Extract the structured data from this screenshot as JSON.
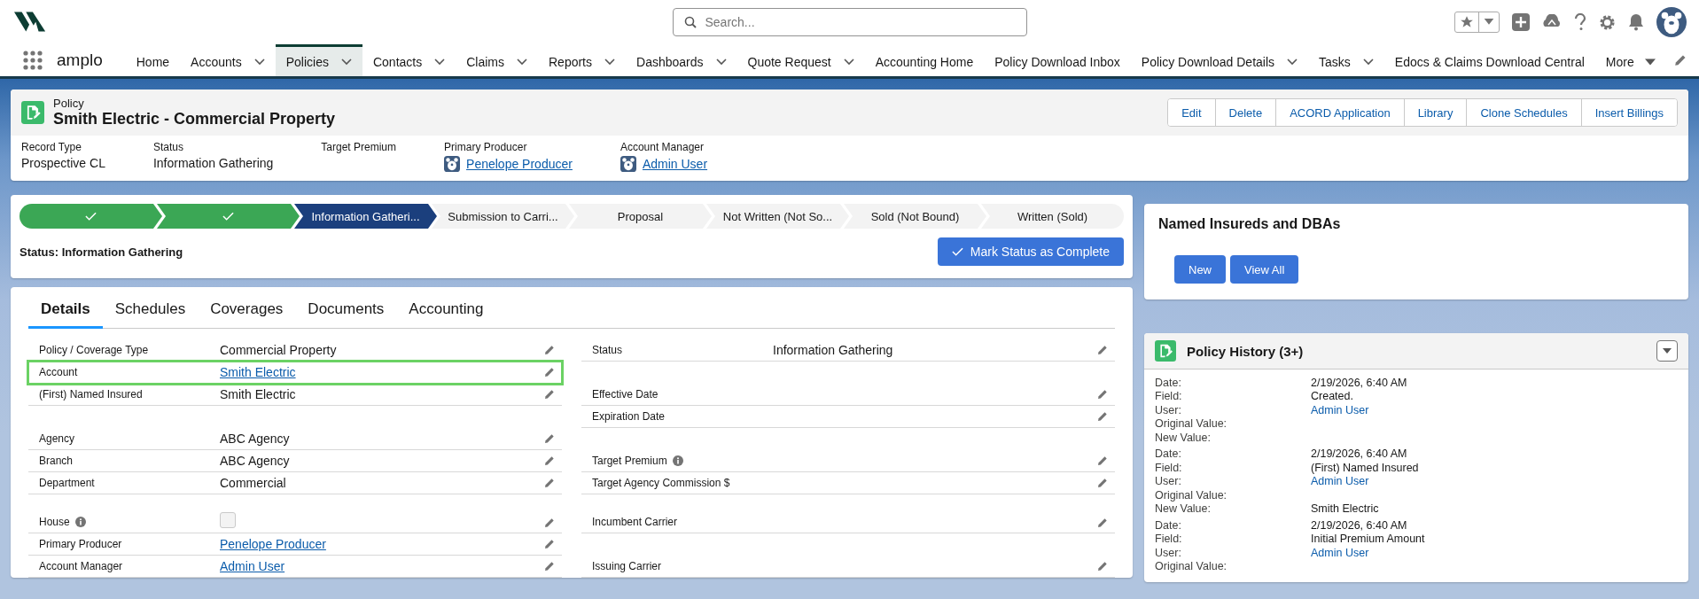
{
  "header": {
    "search": {
      "placeholder": "Search..."
    }
  },
  "nav": {
    "app_name": "amplo",
    "items": [
      {
        "label": "Home",
        "dropdown": false,
        "selected": false
      },
      {
        "label": "Accounts",
        "dropdown": true,
        "selected": false
      },
      {
        "label": "Policies",
        "dropdown": true,
        "selected": true
      },
      {
        "label": "Contacts",
        "dropdown": true,
        "selected": false
      },
      {
        "label": "Claims",
        "dropdown": true,
        "selected": false
      },
      {
        "label": "Reports",
        "dropdown": true,
        "selected": false
      },
      {
        "label": "Dashboards",
        "dropdown": true,
        "selected": false
      },
      {
        "label": "Quote Request",
        "dropdown": true,
        "selected": false
      },
      {
        "label": "Accounting Home",
        "dropdown": false,
        "selected": false
      },
      {
        "label": "Policy Download Inbox",
        "dropdown": false,
        "selected": false
      },
      {
        "label": "Policy Download Details",
        "dropdown": true,
        "selected": false
      },
      {
        "label": "Tasks",
        "dropdown": true,
        "selected": false
      },
      {
        "label": "Edocs & Claims Download Central",
        "dropdown": false,
        "selected": false
      }
    ],
    "more": "More"
  },
  "record": {
    "object": "Policy",
    "title": "Smith Electric - Commercial Property",
    "actions": [
      "Edit",
      "Delete",
      "ACORD Application",
      "Library",
      "Clone Schedules",
      "Insert Billings"
    ],
    "highlights": [
      {
        "label": "Record Type",
        "value": "Prospective CL"
      },
      {
        "label": "Status",
        "value": "Information Gathering"
      },
      {
        "label": "Target Premium"
      },
      {
        "label": "Primary Producer",
        "value": "Penelope Producer",
        "kind": "user"
      },
      {
        "label": "Account Manager",
        "value": "Admin User",
        "kind": "user"
      }
    ]
  },
  "path": {
    "stages": [
      {
        "kind": "complete"
      },
      {
        "kind": "complete"
      },
      {
        "kind": "current",
        "label": "Information Gatheri..."
      },
      {
        "kind": "incomplete",
        "label": "Submission to Carri..."
      },
      {
        "kind": "incomplete",
        "label": "Proposal"
      },
      {
        "kind": "incomplete",
        "label": "Not Written (Not So..."
      },
      {
        "kind": "incomplete",
        "label": "Sold (Not Bound)"
      },
      {
        "kind": "incomplete",
        "label": "Written (Sold)"
      }
    ],
    "status_text": "Status: Information Gathering",
    "mark_button": "Mark Status as Complete"
  },
  "details": {
    "tabs": [
      {
        "label": "Details",
        "selected": true
      },
      {
        "label": "Schedules",
        "selected": false
      },
      {
        "label": "Coverages",
        "selected": false
      },
      {
        "label": "Documents",
        "selected": false
      },
      {
        "label": "Accounting",
        "selected": false
      }
    ],
    "rows": [
      {
        "left": {
          "label": "Policy / Coverage Type",
          "value": "Commercial Property"
        },
        "right": {
          "label": "Status",
          "value": "Information Gathering"
        }
      },
      {
        "left": {
          "label": "Account",
          "value": "Smith Electric",
          "kind": "link",
          "highlighted": true
        }
      },
      {
        "left": {
          "label": "(First) Named Insured",
          "value": "Smith Electric"
        },
        "right": {
          "label": "Effective Date"
        }
      },
      {
        "right": {
          "label": "Expiration Date"
        }
      },
      {
        "left": {
          "label": "Agency",
          "value": "ABC Agency"
        }
      },
      {
        "left": {
          "label": "Branch",
          "value": "ABC Agency"
        },
        "right": {
          "label": "Target Premium",
          "info": true
        }
      },
      {
        "left": {
          "label": "Department",
          "value": "Commercial"
        },
        "right": {
          "label": "Target Agency Commission $"
        }
      },
      {
        "tall": true,
        "left": {
          "label": "House",
          "kind": "checkbox",
          "checked": false,
          "info": true
        },
        "right": {
          "label": "Incumbent Carrier"
        }
      },
      {
        "left": {
          "label": "Primary Producer",
          "value": "Penelope Producer",
          "kind": "link"
        }
      },
      {
        "left": {
          "label": "Account Manager",
          "value": "Admin User",
          "kind": "link"
        },
        "right": {
          "label": "Issuing Carrier"
        }
      }
    ]
  },
  "named_insureds": {
    "title": "Named Insureds and DBAs",
    "buttons": [
      "New",
      "View All"
    ]
  },
  "history": {
    "title": "Policy History (3+)",
    "entries": [
      {
        "rows": [
          {
            "label": "Date:",
            "value": "2/19/2026, 6:40 AM"
          },
          {
            "label": "Field:",
            "value": "Created."
          },
          {
            "label": "User:",
            "value": "Admin User",
            "kind": "link"
          },
          {
            "label": "Original Value:"
          },
          {
            "label": "New Value:"
          }
        ]
      },
      {
        "rows": [
          {
            "label": "Date:",
            "value": "2/19/2026, 6:40 AM"
          },
          {
            "label": "Field:",
            "value": "(First) Named Insured"
          },
          {
            "label": "User:",
            "value": "Admin User",
            "kind": "link"
          },
          {
            "label": "Original Value:"
          },
          {
            "label": "New Value:",
            "value": "Smith Electric"
          }
        ]
      },
      {
        "rows": [
          {
            "label": "Date:",
            "value": "2/19/2026, 6:40 AM"
          },
          {
            "label": "Field:",
            "value": "Initial Premium Amount"
          },
          {
            "label": "User:",
            "value": "Admin User",
            "kind": "link"
          },
          {
            "label": "Original Value:"
          }
        ]
      }
    ]
  }
}
